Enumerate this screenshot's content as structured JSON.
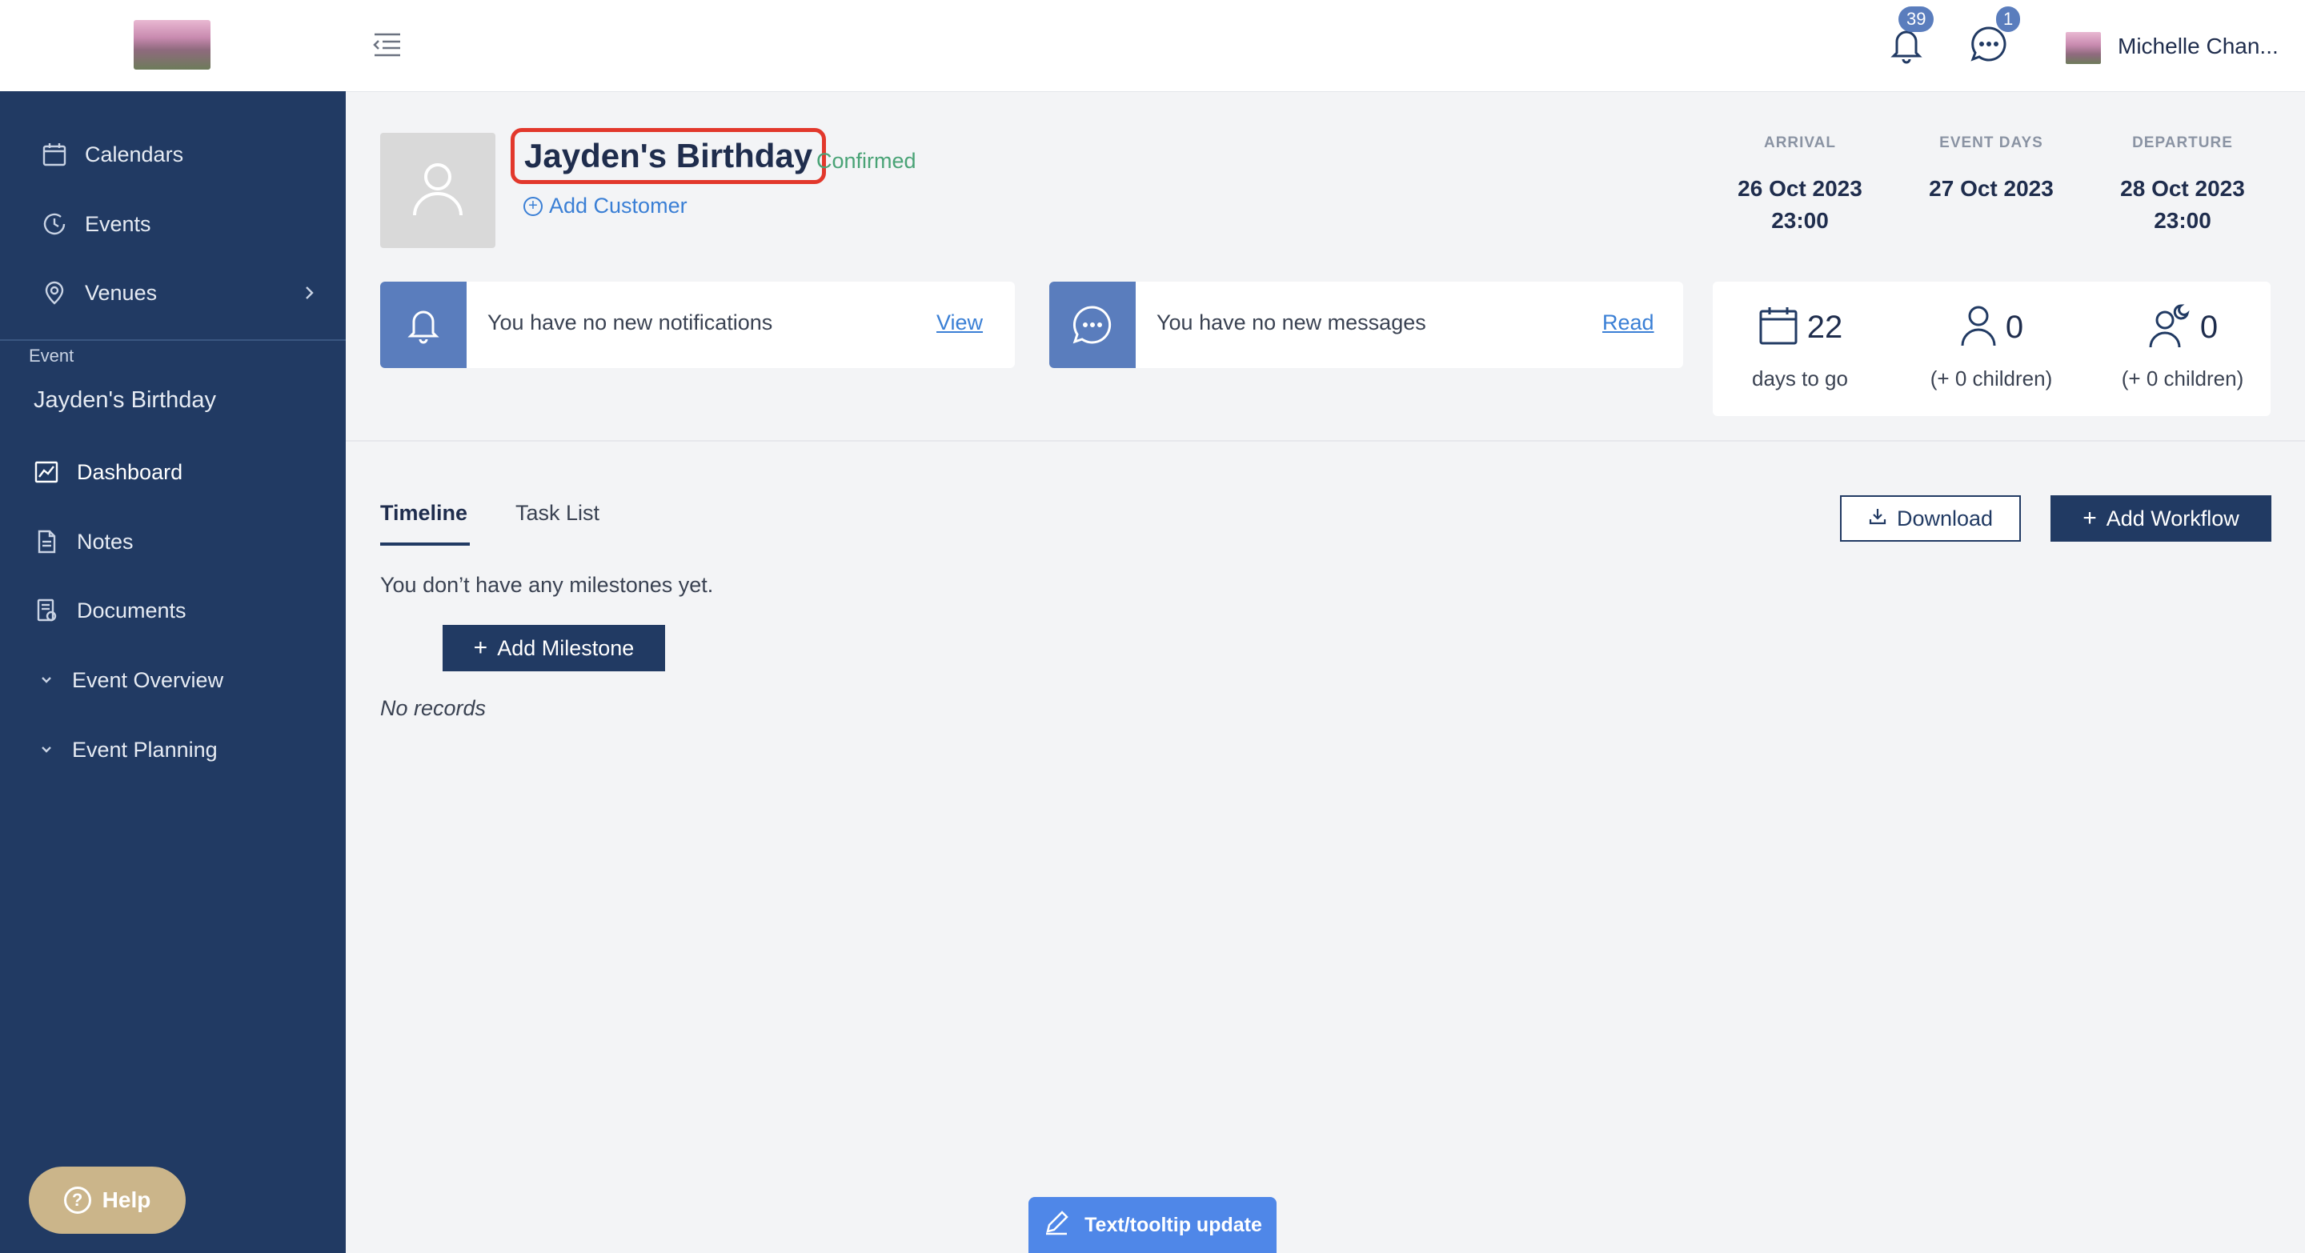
{
  "sidebar": {
    "nav": [
      {
        "label": "Calendars",
        "icon": "calendar-icon"
      },
      {
        "label": "Events",
        "icon": "clock-icon"
      },
      {
        "label": "Venues",
        "icon": "map-pin-icon"
      }
    ],
    "section_label": "Event",
    "event_name": "Jayden's Birthday",
    "event_nav": [
      {
        "label": "Dashboard",
        "icon": "chart-icon",
        "active": true
      },
      {
        "label": "Notes",
        "icon": "note-icon"
      },
      {
        "label": "Documents",
        "icon": "document-icon"
      },
      {
        "label": "Event Overview",
        "icon": "chevron-down-icon"
      },
      {
        "label": "Event Planning",
        "icon": "chevron-down-icon"
      }
    ],
    "help_label": "Help"
  },
  "header": {
    "notifications_count": "39",
    "messages_count": "1",
    "user_name": "Michelle Chan..."
  },
  "event": {
    "title": "Jayden's Birthday",
    "status": "Confirmed",
    "add_customer_label": "Add Customer",
    "arrival": {
      "label": "ARRIVAL",
      "date": "26 Oct 2023",
      "time": "23:00"
    },
    "event_days": {
      "label": "EVENT DAYS",
      "date": "27 Oct 2023"
    },
    "departure": {
      "label": "DEPARTURE",
      "date": "28 Oct 2023",
      "time": "23:00"
    }
  },
  "cards": {
    "notifications": {
      "text": "You have no new notifications",
      "link": "View"
    },
    "messages": {
      "text": "You have no new messages",
      "link": "Read"
    }
  },
  "stats": {
    "days": {
      "value": "22",
      "label": "days to go"
    },
    "adults": {
      "value": "0",
      "label": "(+ 0 children)"
    },
    "overnight": {
      "value": "0",
      "label": "(+ 0 children)"
    }
  },
  "tabs": [
    {
      "label": "Timeline",
      "active": true
    },
    {
      "label": "Task List",
      "active": false
    }
  ],
  "actions": {
    "download_label": "Download",
    "add_workflow_label": "Add Workflow",
    "add_milestone_label": "Add Milestone"
  },
  "timeline": {
    "empty_message": "You don’t have any milestones yet.",
    "no_records": "No records"
  },
  "tooltip_update_label": "Text/tooltip update",
  "colors": {
    "sidebar": "#213a63",
    "accent_blue": "#5a7dbd",
    "status_green": "#49a376",
    "highlight_red": "#e2382c",
    "help_gold": "#cbb58a"
  }
}
